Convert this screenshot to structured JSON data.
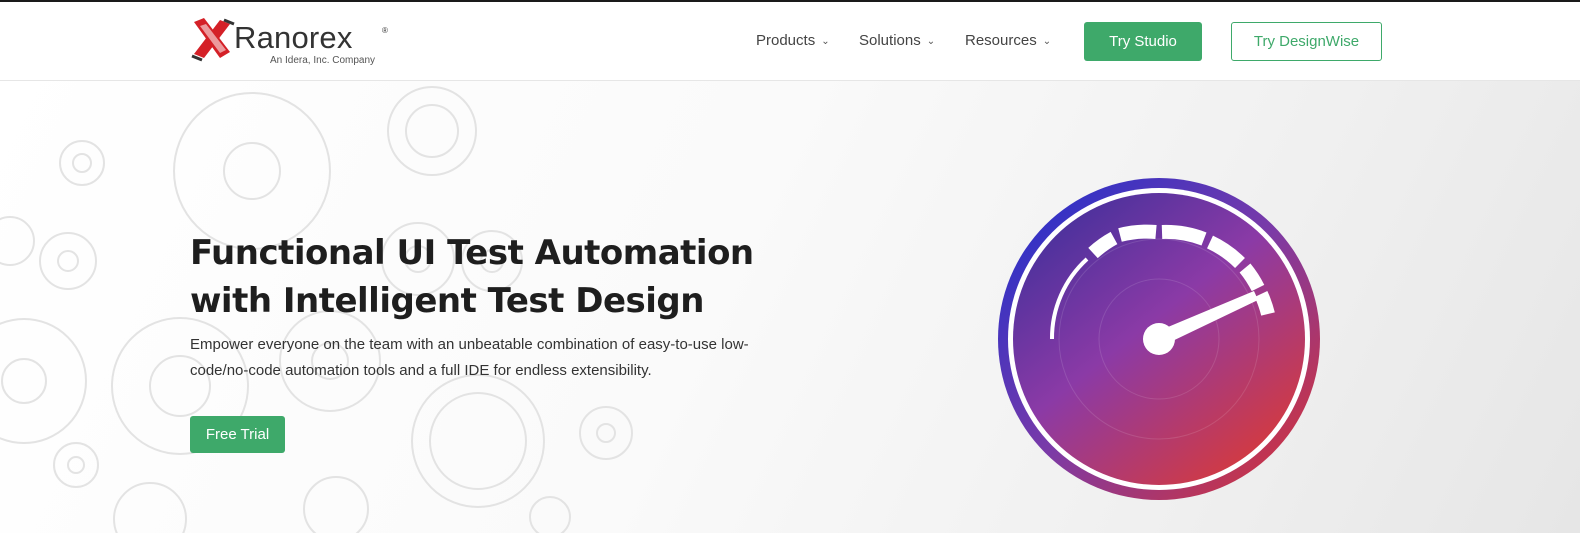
{
  "brand": {
    "name": "Ranorex",
    "registered": "®",
    "tagline": "An Idera, Inc. Company"
  },
  "nav": {
    "items": [
      {
        "label": "Products"
      },
      {
        "label": "Solutions"
      },
      {
        "label": "Resources"
      }
    ],
    "try_studio": "Try Studio",
    "try_designwise": "Try DesignWise"
  },
  "hero": {
    "headline_line1": "Functional UI Test Automation",
    "headline_line2": "with Intelligent Test Design",
    "description": "Empower everyone on the team with an unbeatable combination of easy-to-use low-code/no-code automation tools and a full IDE for endless extensibility.",
    "cta": "Free Trial"
  },
  "colors": {
    "accent_green": "#3ea96a",
    "gauge_blue": "#1a2fd0",
    "gauge_purple": "#7a3aa8",
    "gauge_red": "#e0322a"
  },
  "icons": [
    "ranorex-logo-icon",
    "chevron-down-icon",
    "speedometer-icon",
    "gear-icon"
  ]
}
